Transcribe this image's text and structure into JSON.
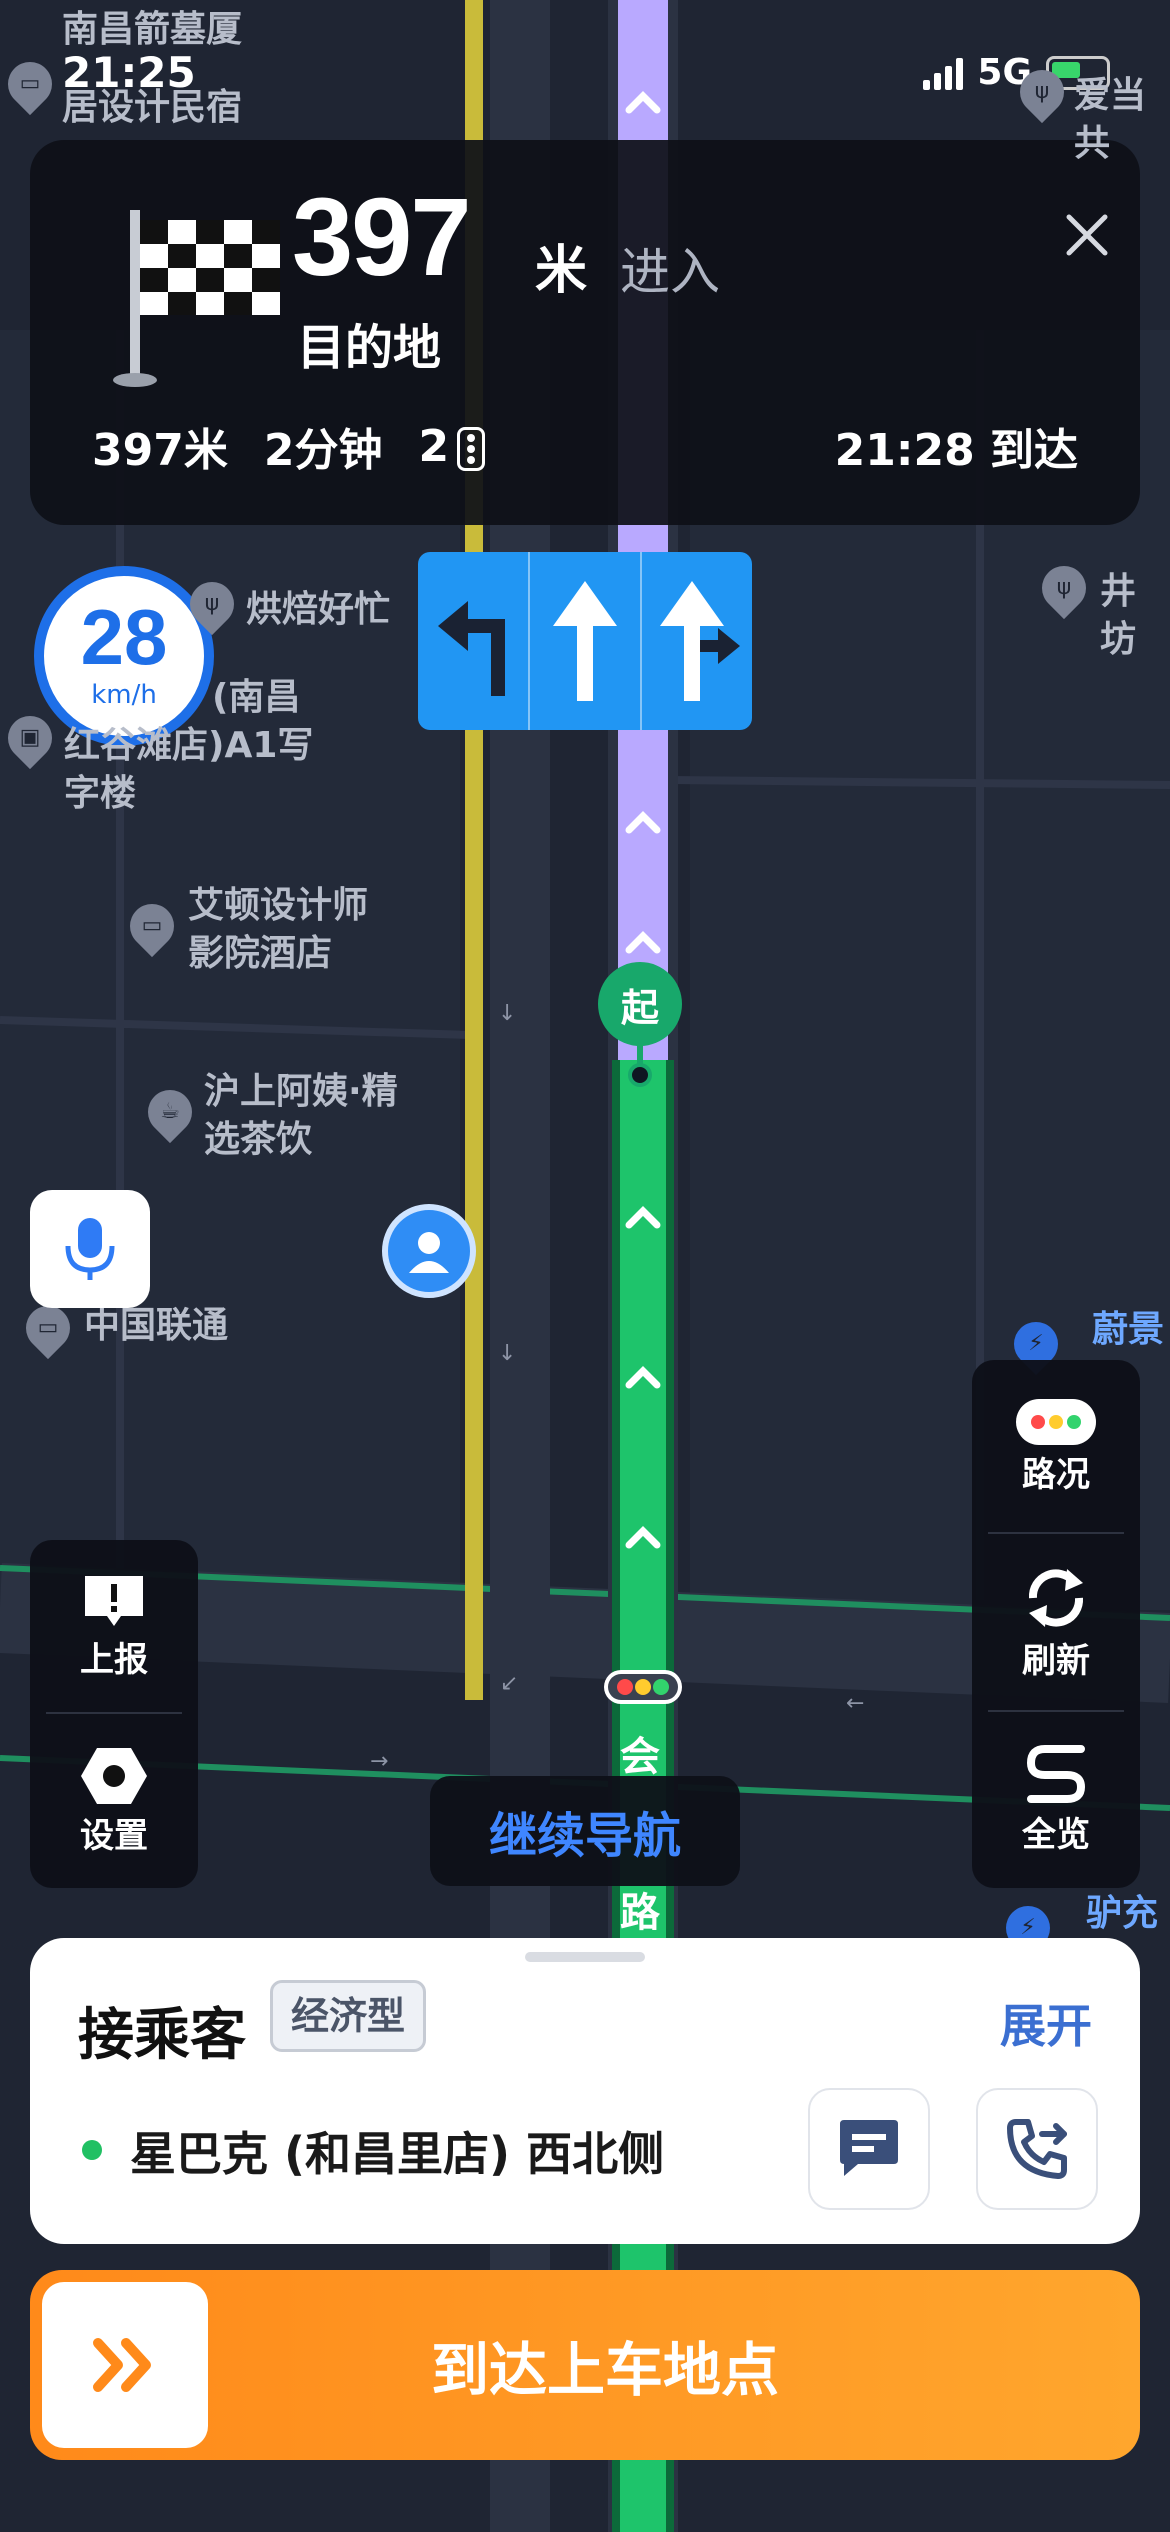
{
  "status_bar": {
    "time": "21:25",
    "network": "5G"
  },
  "navigation": {
    "distance_value": "397",
    "distance_unit": "米",
    "action": "进入",
    "destination": "目的地",
    "summary": {
      "distance": "397米",
      "duration": "2分钟",
      "traffic_lights": "2"
    },
    "arrival": "21:28 到达"
  },
  "speed": {
    "value": "28",
    "unit": "km/h"
  },
  "map": {
    "pois": [
      "南昌箭墓厦",
      "居设计民宿",
      "烘焙好忙",
      "(南昌",
      "红谷滩店)A1写",
      "字楼",
      "艾顿设计师",
      "影院酒店",
      "沪上阿姨·精",
      "选茶饮",
      "中国联通",
      "蔚景",
      "井坊",
      "驴充",
      "爱当共"
    ],
    "road_labels": [
      "会",
      "路"
    ],
    "start_marker": "起"
  },
  "left_panel": {
    "report": "上报",
    "settings": "设置"
  },
  "right_panel": {
    "traffic": "路况",
    "refresh": "刷新",
    "overview": "全览"
  },
  "continue_nav": "继续导航",
  "sheet": {
    "title": "接乘客",
    "tag": "经济型",
    "expand": "展开",
    "pickup_place": "星巴克 (和昌里店) 西北侧"
  },
  "action_button": {
    "label": "到达上车地点"
  },
  "colors": {
    "route_green": "#1ec46b",
    "route_purple": "#b9a9ff",
    "accent_orange": "#ff8a1a",
    "speed_blue": "#1e6fe8"
  }
}
